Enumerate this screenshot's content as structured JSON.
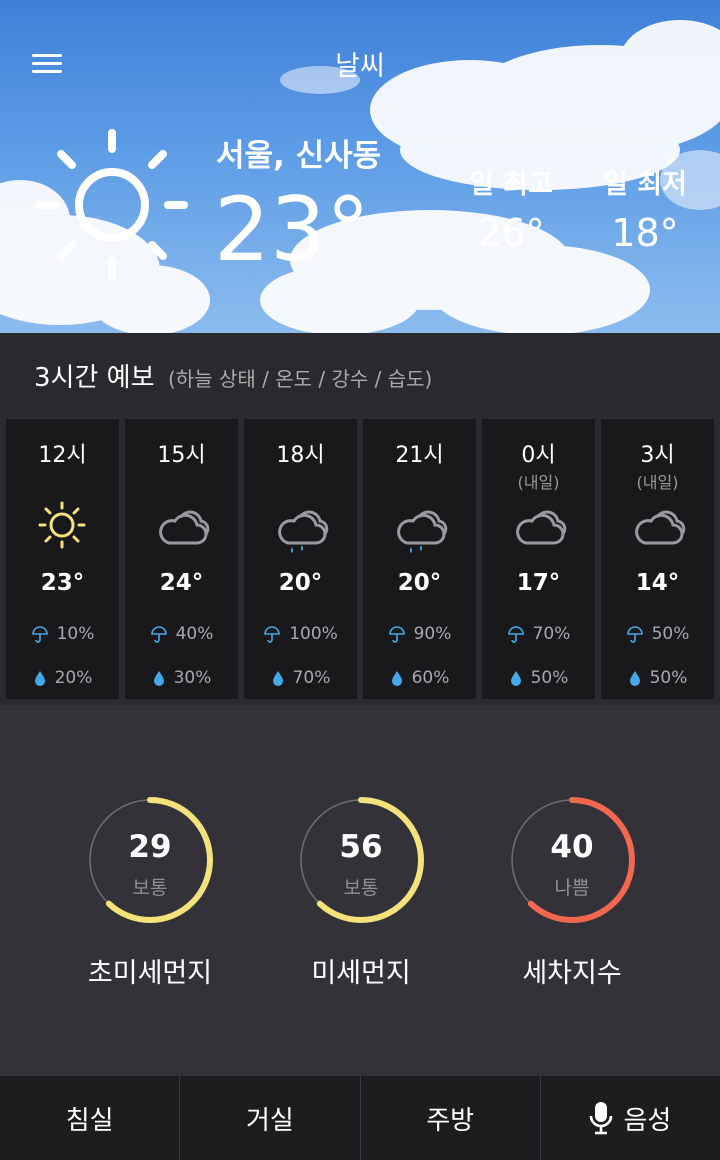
{
  "header": {
    "title": "날씨",
    "location": "서울, 신사동",
    "temperature": "23°",
    "high_label": "일 최고",
    "high_value": "26°",
    "low_label": "일 최저",
    "low_value": "18°",
    "icon": "sun-icon"
  },
  "forecast": {
    "title": "3시간 예보",
    "subtitle": "(하늘 상태 / 온도 / 강수 / 습도)",
    "items": [
      {
        "time": "12시",
        "sub": "",
        "icon": "sun-icon",
        "temp": "23°",
        "pop": "10%",
        "humidity": "20%"
      },
      {
        "time": "15시",
        "sub": "",
        "icon": "cloud-icon",
        "temp": "24°",
        "pop": "40%",
        "humidity": "30%"
      },
      {
        "time": "18시",
        "sub": "",
        "icon": "rain-cloud-icon",
        "temp": "20°",
        "pop": "100%",
        "humidity": "70%"
      },
      {
        "time": "21시",
        "sub": "",
        "icon": "rain-cloud-icon",
        "temp": "20°",
        "pop": "90%",
        "humidity": "60%"
      },
      {
        "time": "0시",
        "sub": "(내일)",
        "icon": "cloud-icon",
        "temp": "17°",
        "pop": "70%",
        "humidity": "50%"
      },
      {
        "time": "3시",
        "sub": "(내일)",
        "icon": "cloud-icon",
        "temp": "14°",
        "pop": "50%",
        "humidity": "50%"
      }
    ]
  },
  "air": {
    "items": [
      {
        "value": "29",
        "grade": "보통",
        "label": "초미세먼지",
        "fraction": 0.62,
        "color": "#f6e27a"
      },
      {
        "value": "56",
        "grade": "보통",
        "label": "미세먼지",
        "fraction": 0.62,
        "color": "#f6e27a"
      },
      {
        "value": "40",
        "grade": "나쁨",
        "label": "세차지수",
        "fraction": 0.62,
        "color": "#f2674f"
      }
    ]
  },
  "nav": {
    "items": [
      {
        "label": "침실"
      },
      {
        "label": "거실"
      },
      {
        "label": "주방"
      },
      {
        "label": "음성",
        "icon": "microphone-icon"
      }
    ]
  },
  "colors": {
    "accent_blue": "#46a8e8",
    "sun_yellow": "#f6e27a",
    "bad_red": "#f2674f"
  }
}
